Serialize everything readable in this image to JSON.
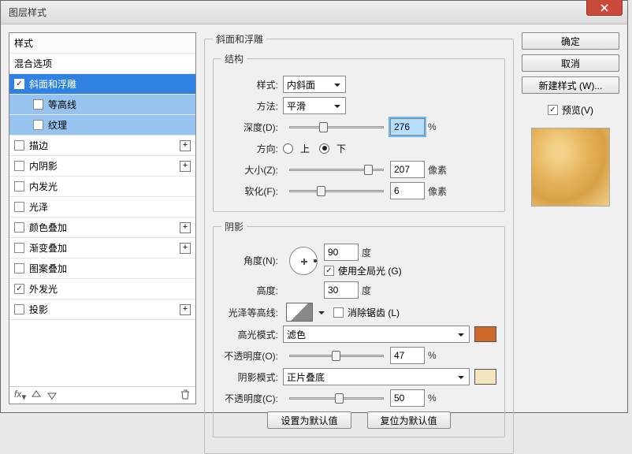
{
  "window": {
    "title": "图层样式"
  },
  "sidebar": {
    "header": "样式",
    "rows": [
      {
        "label": "混合选项",
        "checked": null,
        "plus": false
      },
      {
        "label": "斜面和浮雕",
        "checked": true,
        "selected": true
      },
      {
        "label": "等高线",
        "checked": false,
        "indent": true,
        "sub": true
      },
      {
        "label": "纹理",
        "checked": false,
        "indent": true,
        "sub": true
      },
      {
        "label": "描边",
        "checked": false,
        "plus": true
      },
      {
        "label": "内阴影",
        "checked": false,
        "plus": true
      },
      {
        "label": "内发光",
        "checked": false
      },
      {
        "label": "光泽",
        "checked": false
      },
      {
        "label": "颜色叠加",
        "checked": false,
        "plus": true
      },
      {
        "label": "渐变叠加",
        "checked": false,
        "plus": true
      },
      {
        "label": "图案叠加",
        "checked": false
      },
      {
        "label": "外发光",
        "checked": true
      },
      {
        "label": "投影",
        "checked": false,
        "plus": true
      }
    ]
  },
  "group": {
    "main": "斜面和浮雕",
    "structure_legend": "结构",
    "shadow_legend": "阴影"
  },
  "structure": {
    "style_label": "样式:",
    "style_value": "内斜面",
    "method_label": "方法:",
    "method_value": "平滑",
    "depth_label": "深度(D):",
    "depth_value": "276",
    "depth_unit": "%",
    "direction_label": "方向:",
    "dir_up": "上",
    "dir_down": "下",
    "dir_selected": "down",
    "size_label": "大小(Z):",
    "size_value": "207",
    "size_unit": "像素",
    "soften_label": "软化(F):",
    "soften_value": "6",
    "soften_unit": "像素"
  },
  "shadow": {
    "angle_label": "角度(N):",
    "angle_value": "90",
    "angle_unit": "度",
    "global_light_label": "使用全局光 (G)",
    "global_light_checked": true,
    "altitude_label": "高度:",
    "altitude_value": "30",
    "altitude_unit": "度",
    "contour_label": "光泽等高线:",
    "antialias_label": "消除锯齿 (L)",
    "antialias_checked": false,
    "highlight_mode_label": "高光模式:",
    "highlight_mode_value": "滤色",
    "highlight_swatch": "#cd6a2b",
    "highlight_opacity_label": "不透明度(O):",
    "highlight_opacity_value": "47",
    "highlight_opacity_unit": "%",
    "shadow_mode_label": "阴影模式:",
    "shadow_mode_value": "正片叠底",
    "shadow_swatch": "#f0e5bd",
    "shadow_opacity_label": "不透明度(C):",
    "shadow_opacity_value": "50",
    "shadow_opacity_unit": "%"
  },
  "bottom_buttons": {
    "set_default": "设置为默认值",
    "reset_default": "复位为默认值"
  },
  "right": {
    "ok": "确定",
    "cancel": "取消",
    "new_style": "新建样式 (W)...",
    "preview_label": "预览(V)",
    "preview_checked": true
  }
}
